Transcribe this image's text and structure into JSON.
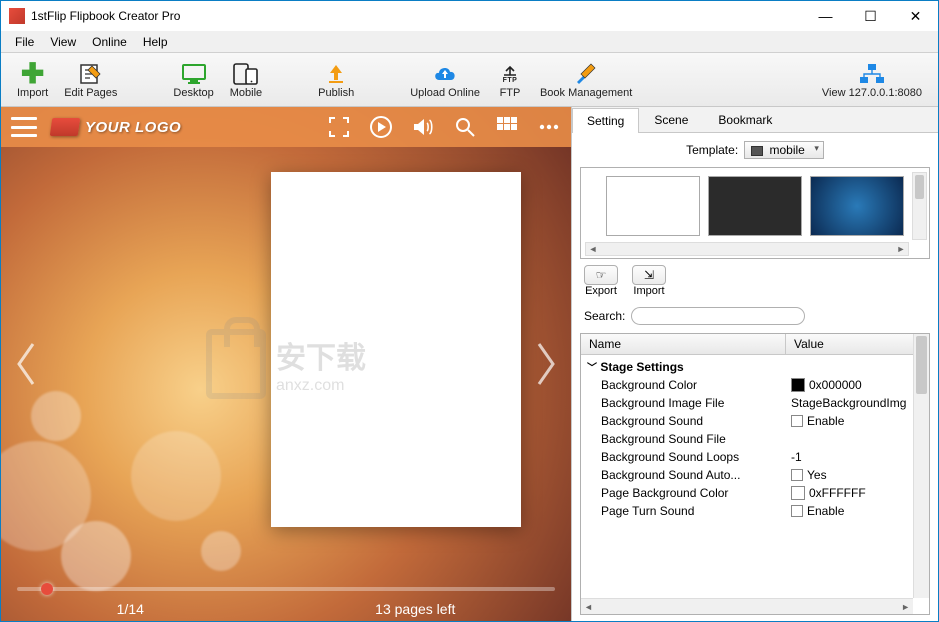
{
  "window": {
    "title": "1stFlip Flipbook Creator Pro"
  },
  "menu": {
    "file": "File",
    "view": "View",
    "online": "Online",
    "help": "Help"
  },
  "toolbar": {
    "import": "Import",
    "editpages": "Edit Pages",
    "desktop": "Desktop",
    "mobile": "Mobile",
    "publish": "Publish",
    "upload": "Upload Online",
    "ftp": "FTP",
    "bookmgmt": "Book Management",
    "viewaddr": "View 127.0.0.1:8080"
  },
  "preview": {
    "logo": "YOUR LOGO",
    "page_indicator": "1/14",
    "pages_left": "13 pages left",
    "watermark_text": "安下载",
    "watermark_sub": "anxz.com"
  },
  "tabs": {
    "setting": "Setting",
    "scene": "Scene",
    "bookmark": "Bookmark"
  },
  "template": {
    "label": "Template:",
    "value": "mobile"
  },
  "thumbs": {
    "white": "White",
    "black": "Black",
    "abstract": "Abstract"
  },
  "io": {
    "export": "Export",
    "import": "Import"
  },
  "search": {
    "label": "Search:",
    "placeholder": ""
  },
  "grid": {
    "head_name": "Name",
    "head_value": "Value",
    "group": "Stage Settings",
    "rows": [
      {
        "n": "Background Color",
        "v": "0x000000",
        "swatch": "#000000"
      },
      {
        "n": "Background Image File",
        "v": "StageBackgroundImg"
      },
      {
        "n": "Background Sound",
        "v": "Enable",
        "check": true
      },
      {
        "n": "Background Sound File",
        "v": ""
      },
      {
        "n": "Background Sound Loops",
        "v": "-1"
      },
      {
        "n": "Background Sound Auto...",
        "v": "Yes",
        "check": true
      },
      {
        "n": "Page Background Color",
        "v": "0xFFFFFF",
        "swatch": "#ffffff"
      },
      {
        "n": "Page Turn Sound",
        "v": "Enable",
        "check": true
      }
    ]
  }
}
